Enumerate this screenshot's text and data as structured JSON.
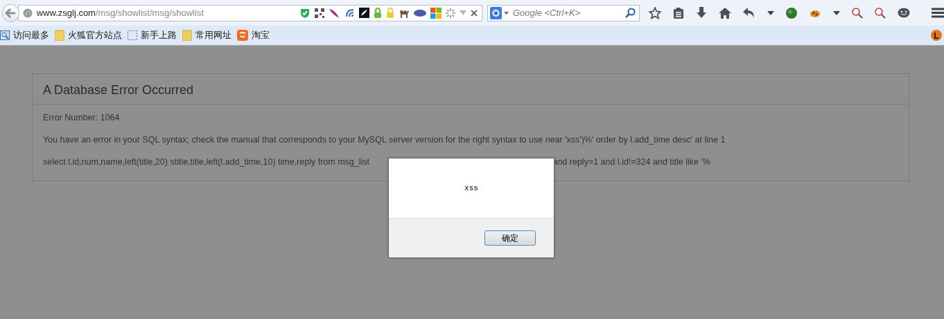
{
  "browser": {
    "url": {
      "host": "www.zsglj.com",
      "path": "/msg/showlist/msg/showlist"
    },
    "search": {
      "placeholder": "Google <Ctrl+K>"
    },
    "bookmarks": [
      {
        "kind": "frequent",
        "label": "访问最多"
      },
      {
        "kind": "folder",
        "label": "火狐官方站点"
      },
      {
        "kind": "page",
        "label": "新手上路"
      },
      {
        "kind": "folder",
        "label": "常用网址"
      },
      {
        "kind": "shop",
        "label": "淘宝"
      }
    ]
  },
  "error": {
    "title": "A Database Error Occurred",
    "number": "Error Number: 1064",
    "message": "You have an error in your SQL syntax; check the manual that corresponds to your MySQL server version for the right syntax to use near 'xss')%' order by l.add_time desc' at line 1",
    "query_parts": [
      "select l.id,num,name,left(title,20) stitle,title,left(l.add_time,10) time,reply from msg_list",
      "and reply=1 and l.id!=324 and title like '%"
    ]
  },
  "dialog": {
    "message": "xss",
    "button": "确定"
  }
}
